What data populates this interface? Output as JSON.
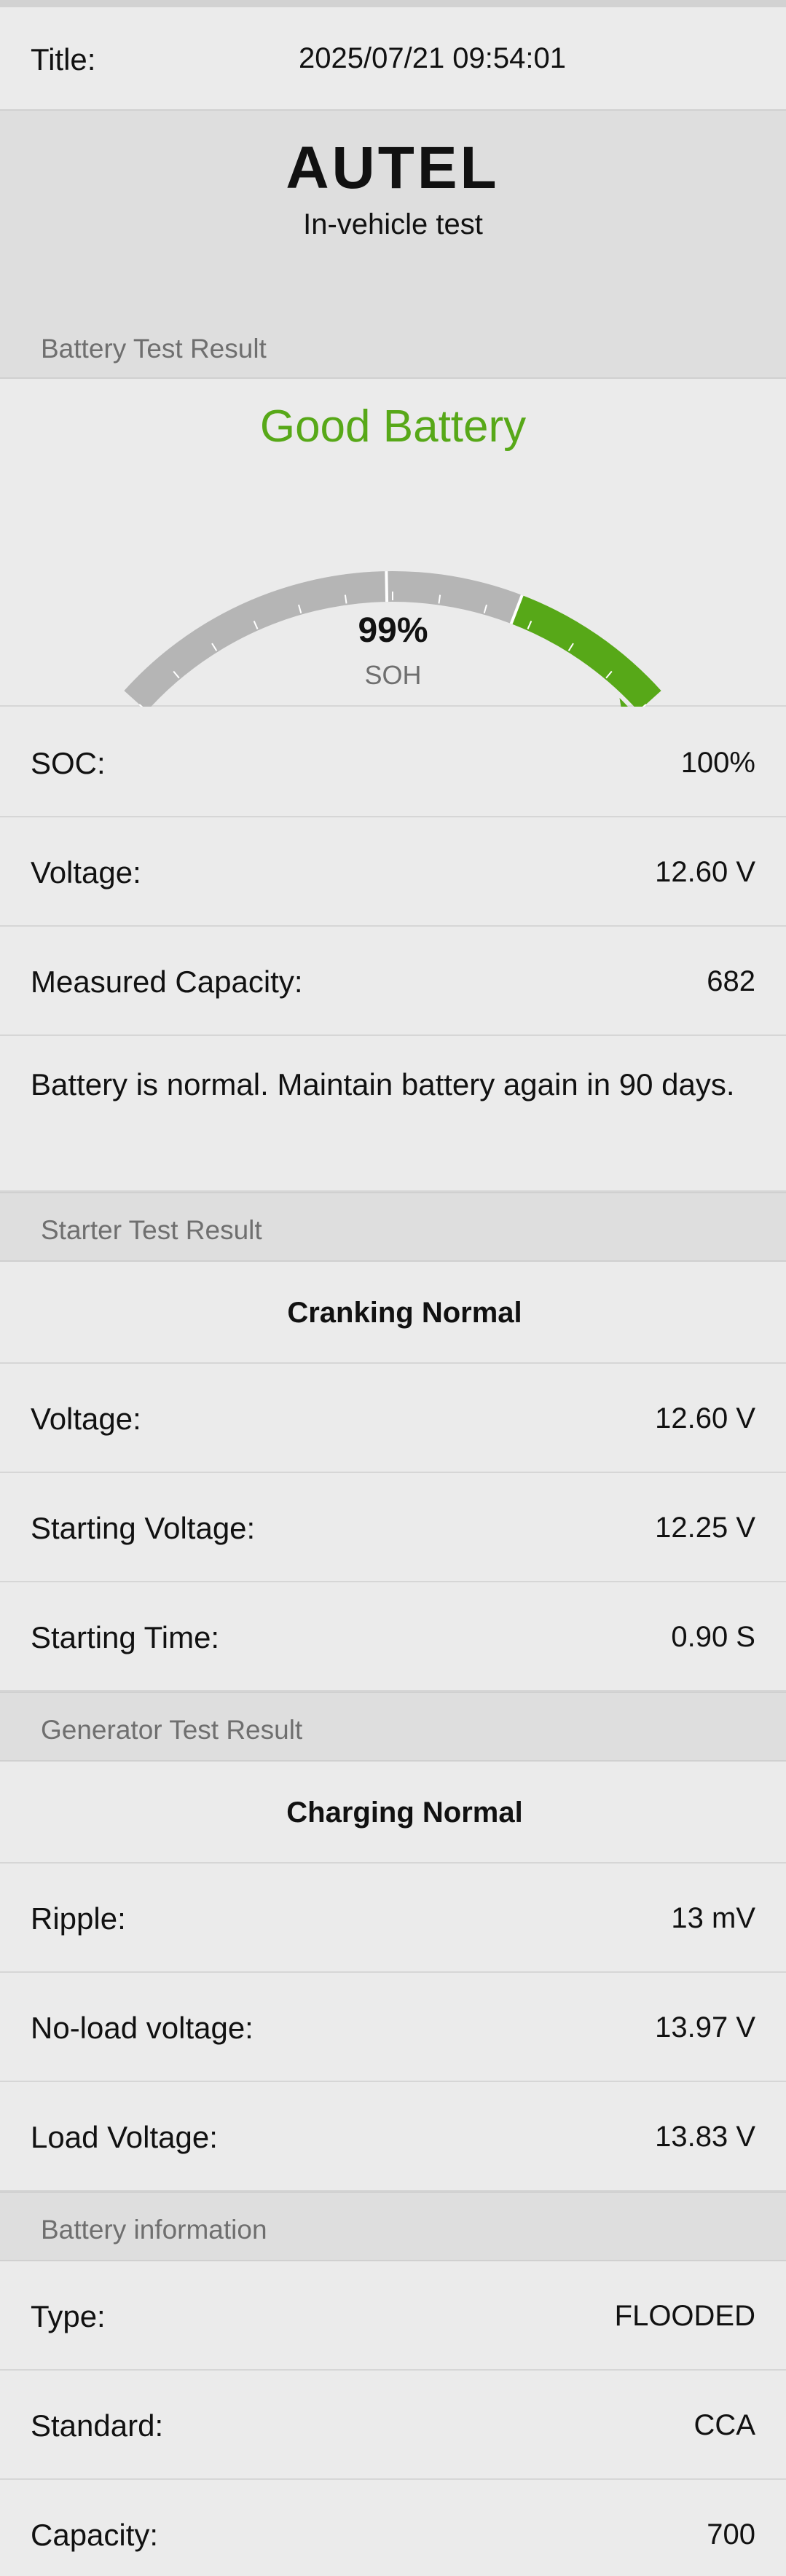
{
  "title_row": {
    "label": "Title:",
    "value": "2025/07/21 09:54:01"
  },
  "header": {
    "logo_text": "AUTEL",
    "subtitle": "In-vehicle test"
  },
  "battery_section": {
    "heading": "Battery Test Result",
    "status": "Good Battery",
    "status_color": "#57a818",
    "gauge": {
      "value_text": "99%",
      "label": "SOH",
      "fraction": 0.99
    },
    "rows": [
      {
        "label": "SOC:",
        "value": "100%"
      },
      {
        "label": "Voltage:",
        "value": "12.60 V"
      },
      {
        "label": "Measured Capacity:",
        "value": "682"
      }
    ],
    "note": "Battery is normal. Maintain battery again in 90 days."
  },
  "starter_section": {
    "heading": "Starter Test Result",
    "status": "Cranking Normal",
    "rows": [
      {
        "label": "Voltage:",
        "value": "12.60 V"
      },
      {
        "label": "Starting Voltage:",
        "value": "12.25 V"
      },
      {
        "label": "Starting Time:",
        "value": "0.90 S"
      }
    ]
  },
  "generator_section": {
    "heading": "Generator Test Result",
    "status": "Charging Normal",
    "rows": [
      {
        "label": "Ripple:",
        "value": "13 mV"
      },
      {
        "label": "No-load voltage:",
        "value": "13.97 V"
      },
      {
        "label": "Load Voltage:",
        "value": "13.83 V"
      }
    ]
  },
  "info_section": {
    "heading": "Battery information",
    "rows": [
      {
        "label": "Type:",
        "value": "FLOODED"
      },
      {
        "label": "Standard:",
        "value": "CCA"
      },
      {
        "label": "Capacity:",
        "value": "700"
      }
    ]
  }
}
